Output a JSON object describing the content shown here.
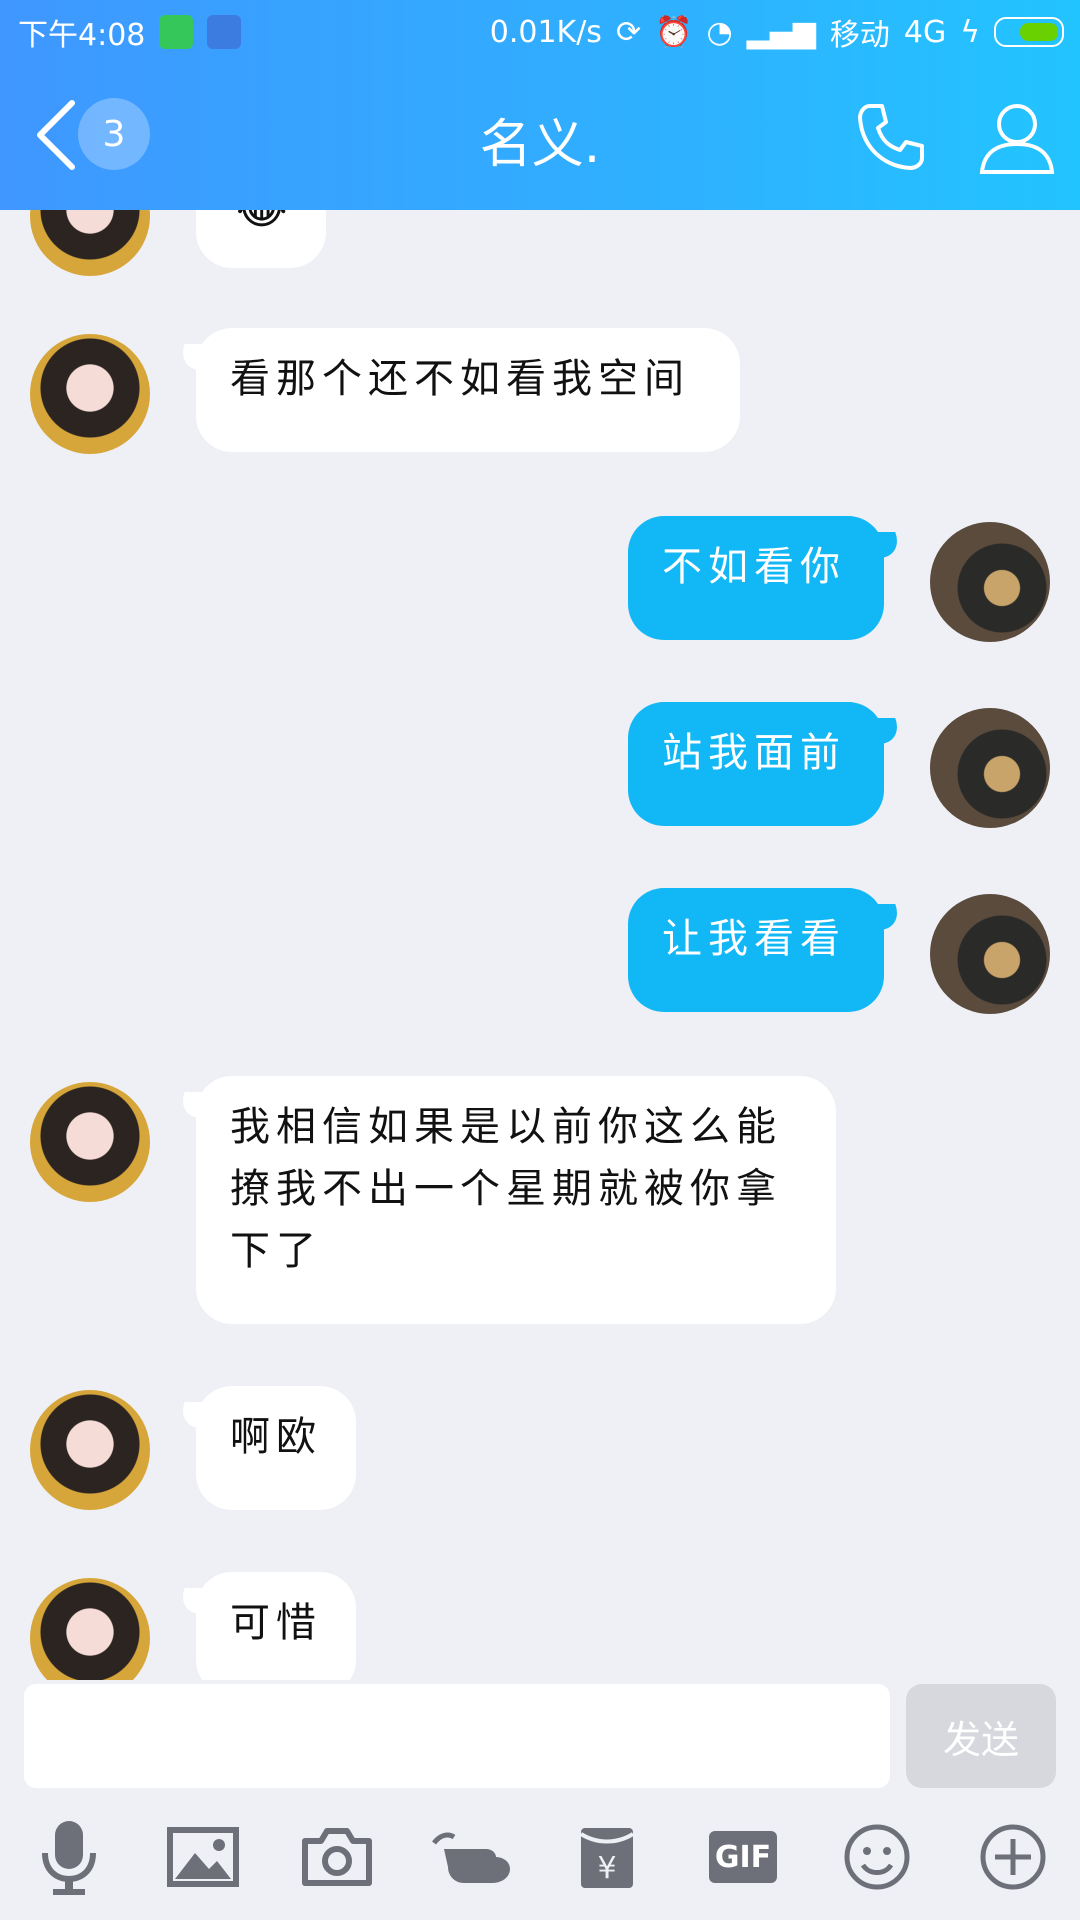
{
  "status_bar": {
    "time": "下午4:08",
    "speed": "0.01K/s",
    "carrier": "移动",
    "network": "4G"
  },
  "header": {
    "unread_count": "3",
    "title": "名义."
  },
  "messages": [
    {
      "side": "in",
      "text": "看那个还不如看我空间"
    },
    {
      "side": "out",
      "text": "不如看你"
    },
    {
      "side": "out",
      "text": "站我面前"
    },
    {
      "side": "out",
      "text": "让我看看"
    },
    {
      "side": "in",
      "text": "我相信如果是以前你这么能撩我不出一个星期就被你拿下了"
    },
    {
      "side": "in",
      "text": "啊欧"
    },
    {
      "side": "in",
      "text": "可惜"
    }
  ],
  "composer": {
    "input_value": "",
    "send_label": "发送"
  },
  "toolbar": {
    "gif_label": "GIF",
    "icons": [
      "mic-icon",
      "image-icon",
      "camera-icon",
      "poke-icon",
      "red-packet-icon",
      "gif-icon",
      "emoji-icon",
      "plus-icon"
    ]
  },
  "colors": {
    "header_start": "#3f97ff",
    "header_end": "#22c4ff",
    "out_bubble": "#12b7f5",
    "in_bubble": "#ffffff",
    "background": "#eef0f6"
  }
}
